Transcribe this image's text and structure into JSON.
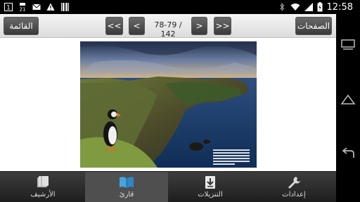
{
  "status_bar": {
    "notification_badge": "1",
    "calendar_day": "21",
    "time": "12:58",
    "icons": [
      "notification-icon",
      "calendar-icon",
      "mail-icon",
      "warning-icon",
      "barcode-icon",
      "bluetooth-icon",
      "wifi-icon",
      "signal-icon",
      "battery-icon"
    ]
  },
  "toolbar": {
    "list_label": "القائمة",
    "first_label": "<<",
    "prev_label": "<",
    "page_indicator": "78-79 / 142",
    "next_label": ">",
    "last_label": ">>",
    "pages_label": "الصفحات"
  },
  "viewer": {
    "image_subject": "puffin on sea cliff"
  },
  "bottom_nav": {
    "items": [
      {
        "label": "الأرشيف",
        "icon": "books-icon",
        "active": false
      },
      {
        "label": "قارئ",
        "icon": "open-book-icon",
        "active": true
      },
      {
        "label": "التنزيلات",
        "icon": "download-icon",
        "active": false
      },
      {
        "label": "إعدادات",
        "icon": "wrench-icon",
        "active": false
      }
    ]
  },
  "colors": {
    "toolbar_button": "#4a4a4a",
    "active_icon": "#4aa3df",
    "nav_background": "#2a2a2a"
  }
}
